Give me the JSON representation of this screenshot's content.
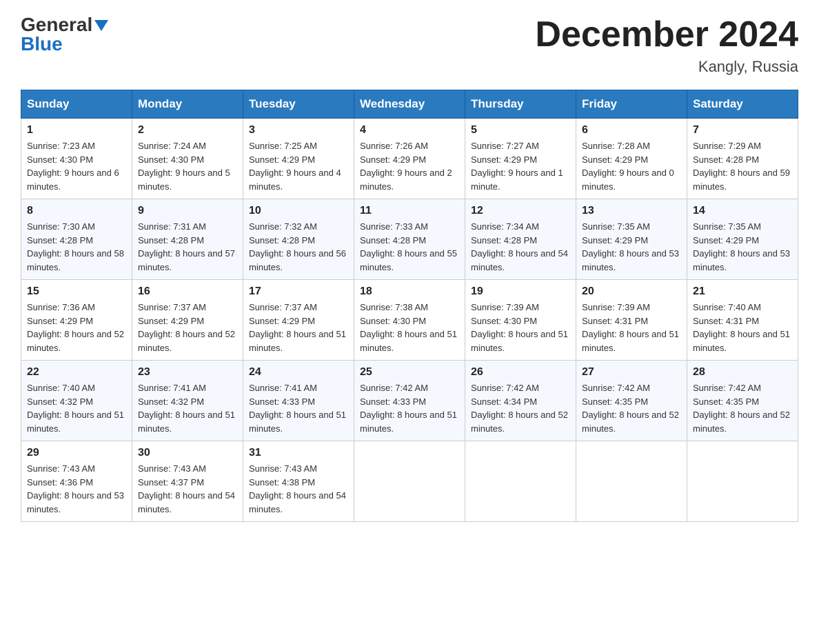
{
  "header": {
    "logo_general": "General",
    "logo_blue": "Blue",
    "month_title": "December 2024",
    "location": "Kangly, Russia"
  },
  "days_of_week": [
    "Sunday",
    "Monday",
    "Tuesday",
    "Wednesday",
    "Thursday",
    "Friday",
    "Saturday"
  ],
  "weeks": [
    [
      {
        "day": "1",
        "sunrise": "7:23 AM",
        "sunset": "4:30 PM",
        "daylight": "9 hours and 6 minutes."
      },
      {
        "day": "2",
        "sunrise": "7:24 AM",
        "sunset": "4:30 PM",
        "daylight": "9 hours and 5 minutes."
      },
      {
        "day": "3",
        "sunrise": "7:25 AM",
        "sunset": "4:29 PM",
        "daylight": "9 hours and 4 minutes."
      },
      {
        "day": "4",
        "sunrise": "7:26 AM",
        "sunset": "4:29 PM",
        "daylight": "9 hours and 2 minutes."
      },
      {
        "day": "5",
        "sunrise": "7:27 AM",
        "sunset": "4:29 PM",
        "daylight": "9 hours and 1 minute."
      },
      {
        "day": "6",
        "sunrise": "7:28 AM",
        "sunset": "4:29 PM",
        "daylight": "9 hours and 0 minutes."
      },
      {
        "day": "7",
        "sunrise": "7:29 AM",
        "sunset": "4:28 PM",
        "daylight": "8 hours and 59 minutes."
      }
    ],
    [
      {
        "day": "8",
        "sunrise": "7:30 AM",
        "sunset": "4:28 PM",
        "daylight": "8 hours and 58 minutes."
      },
      {
        "day": "9",
        "sunrise": "7:31 AM",
        "sunset": "4:28 PM",
        "daylight": "8 hours and 57 minutes."
      },
      {
        "day": "10",
        "sunrise": "7:32 AM",
        "sunset": "4:28 PM",
        "daylight": "8 hours and 56 minutes."
      },
      {
        "day": "11",
        "sunrise": "7:33 AM",
        "sunset": "4:28 PM",
        "daylight": "8 hours and 55 minutes."
      },
      {
        "day": "12",
        "sunrise": "7:34 AM",
        "sunset": "4:28 PM",
        "daylight": "8 hours and 54 minutes."
      },
      {
        "day": "13",
        "sunrise": "7:35 AM",
        "sunset": "4:29 PM",
        "daylight": "8 hours and 53 minutes."
      },
      {
        "day": "14",
        "sunrise": "7:35 AM",
        "sunset": "4:29 PM",
        "daylight": "8 hours and 53 minutes."
      }
    ],
    [
      {
        "day": "15",
        "sunrise": "7:36 AM",
        "sunset": "4:29 PM",
        "daylight": "8 hours and 52 minutes."
      },
      {
        "day": "16",
        "sunrise": "7:37 AM",
        "sunset": "4:29 PM",
        "daylight": "8 hours and 52 minutes."
      },
      {
        "day": "17",
        "sunrise": "7:37 AM",
        "sunset": "4:29 PM",
        "daylight": "8 hours and 51 minutes."
      },
      {
        "day": "18",
        "sunrise": "7:38 AM",
        "sunset": "4:30 PM",
        "daylight": "8 hours and 51 minutes."
      },
      {
        "day": "19",
        "sunrise": "7:39 AM",
        "sunset": "4:30 PM",
        "daylight": "8 hours and 51 minutes."
      },
      {
        "day": "20",
        "sunrise": "7:39 AM",
        "sunset": "4:31 PM",
        "daylight": "8 hours and 51 minutes."
      },
      {
        "day": "21",
        "sunrise": "7:40 AM",
        "sunset": "4:31 PM",
        "daylight": "8 hours and 51 minutes."
      }
    ],
    [
      {
        "day": "22",
        "sunrise": "7:40 AM",
        "sunset": "4:32 PM",
        "daylight": "8 hours and 51 minutes."
      },
      {
        "day": "23",
        "sunrise": "7:41 AM",
        "sunset": "4:32 PM",
        "daylight": "8 hours and 51 minutes."
      },
      {
        "day": "24",
        "sunrise": "7:41 AM",
        "sunset": "4:33 PM",
        "daylight": "8 hours and 51 minutes."
      },
      {
        "day": "25",
        "sunrise": "7:42 AM",
        "sunset": "4:33 PM",
        "daylight": "8 hours and 51 minutes."
      },
      {
        "day": "26",
        "sunrise": "7:42 AM",
        "sunset": "4:34 PM",
        "daylight": "8 hours and 52 minutes."
      },
      {
        "day": "27",
        "sunrise": "7:42 AM",
        "sunset": "4:35 PM",
        "daylight": "8 hours and 52 minutes."
      },
      {
        "day": "28",
        "sunrise": "7:42 AM",
        "sunset": "4:35 PM",
        "daylight": "8 hours and 52 minutes."
      }
    ],
    [
      {
        "day": "29",
        "sunrise": "7:43 AM",
        "sunset": "4:36 PM",
        "daylight": "8 hours and 53 minutes."
      },
      {
        "day": "30",
        "sunrise": "7:43 AM",
        "sunset": "4:37 PM",
        "daylight": "8 hours and 54 minutes."
      },
      {
        "day": "31",
        "sunrise": "7:43 AM",
        "sunset": "4:38 PM",
        "daylight": "8 hours and 54 minutes."
      },
      null,
      null,
      null,
      null
    ]
  ],
  "labels": {
    "sunrise": "Sunrise:",
    "sunset": "Sunset:",
    "daylight": "Daylight:"
  }
}
